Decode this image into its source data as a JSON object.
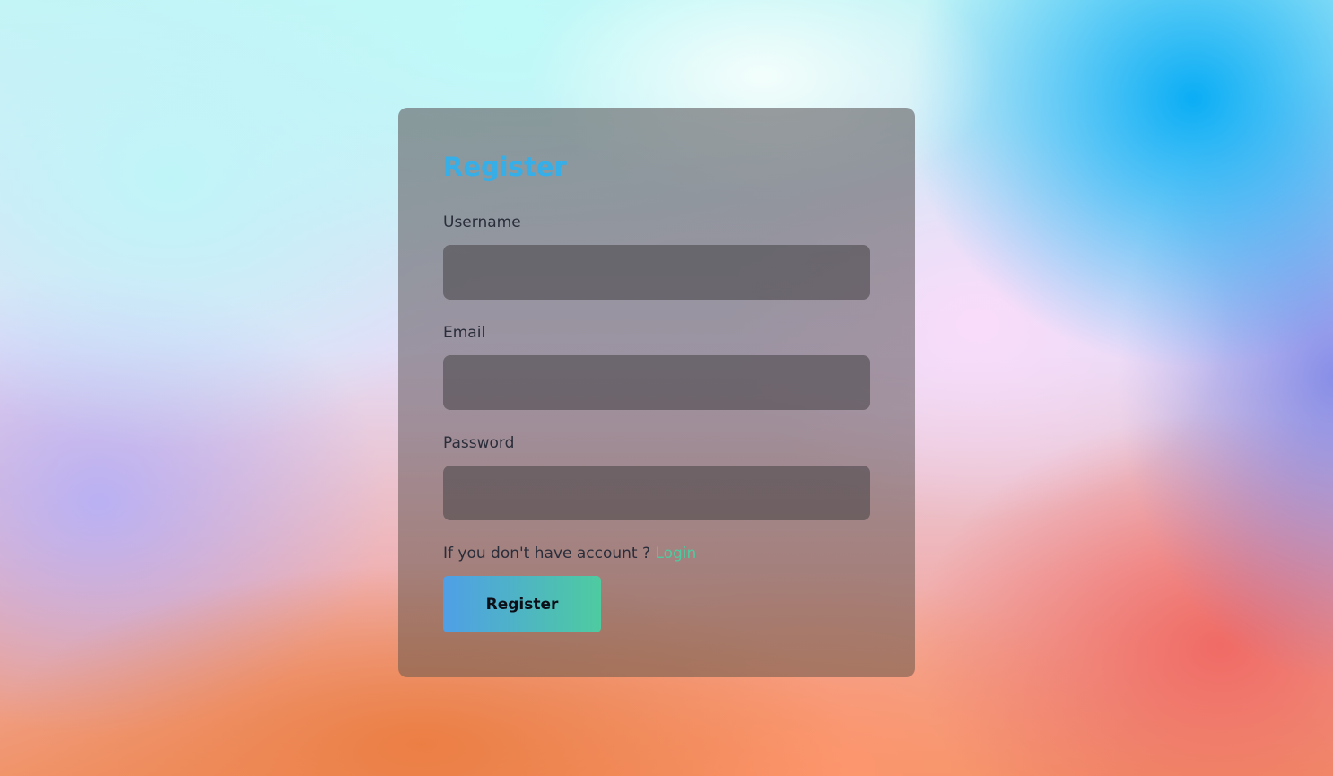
{
  "form": {
    "title": "Register",
    "fields": [
      {
        "label": "Username",
        "value": "",
        "placeholder": ""
      },
      {
        "label": "Email",
        "value": "",
        "placeholder": ""
      },
      {
        "label": "Password",
        "value": "",
        "placeholder": ""
      }
    ],
    "account_prompt": "If you don't have account ?",
    "login_link": "Login",
    "submit_label": "Register"
  },
  "colors": {
    "title": "#36aee8",
    "link": "#4ecba0",
    "button_gradient_start": "#4f9fe6",
    "button_gradient_end": "#4ecba0"
  }
}
